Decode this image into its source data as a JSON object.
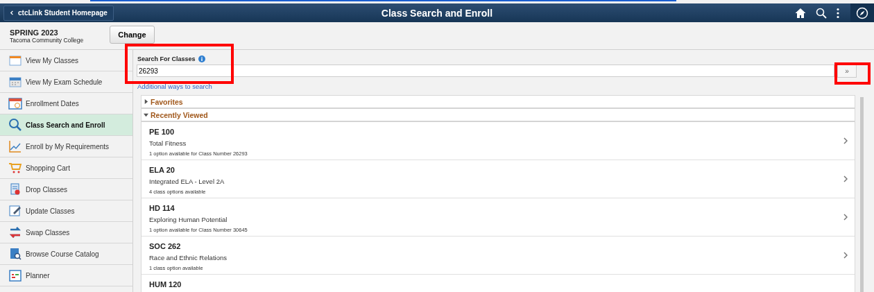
{
  "header": {
    "back_label": "ctcLink Student Homepage",
    "title": "Class Search and Enroll"
  },
  "term": {
    "name": "SPRING 2023",
    "institution": "Tacoma Community College",
    "change_button": "Change"
  },
  "sidebar": {
    "items": [
      {
        "label": "View My Classes",
        "kind": "calendar",
        "selected": false
      },
      {
        "label": "View My Exam Schedule",
        "kind": "exam",
        "selected": false
      },
      {
        "label": "Enrollment Dates",
        "kind": "dates",
        "selected": false
      },
      {
        "label": "Class Search and Enroll",
        "kind": "search",
        "selected": true
      },
      {
        "label": "Enroll by My Requirements",
        "kind": "chart",
        "selected": false
      },
      {
        "label": "Shopping Cart",
        "kind": "cart",
        "selected": false
      },
      {
        "label": "Drop Classes",
        "kind": "drop",
        "selected": false
      },
      {
        "label": "Update Classes",
        "kind": "update",
        "selected": false
      },
      {
        "label": "Swap Classes",
        "kind": "swap",
        "selected": false
      },
      {
        "label": "Browse Course Catalog",
        "kind": "catalog",
        "selected": false
      },
      {
        "label": "Planner",
        "kind": "planner",
        "selected": false
      }
    ]
  },
  "search": {
    "label": "Search For Classes",
    "value": "26293",
    "search_button": "»",
    "link": "Additional ways to search"
  },
  "sections": [
    {
      "title": "Favorites",
      "expanded": false
    },
    {
      "title": "Recently Viewed",
      "expanded": true,
      "courses": [
        {
          "code": "PE 100",
          "title": "Total Fitness",
          "detail": "1 option available for Class Number 26293"
        },
        {
          "code": "ELA 20",
          "title": "Integrated ELA - Level 2A",
          "detail": "4 class options available"
        },
        {
          "code": "HD 114",
          "title": "Exploring Human Potential",
          "detail": "1 option available for Class Number 30645"
        },
        {
          "code": "SOC 262",
          "title": "Race and Ethnic Relations",
          "detail": "1 class option available"
        },
        {
          "code": "HUM 120"
        }
      ]
    }
  ]
}
